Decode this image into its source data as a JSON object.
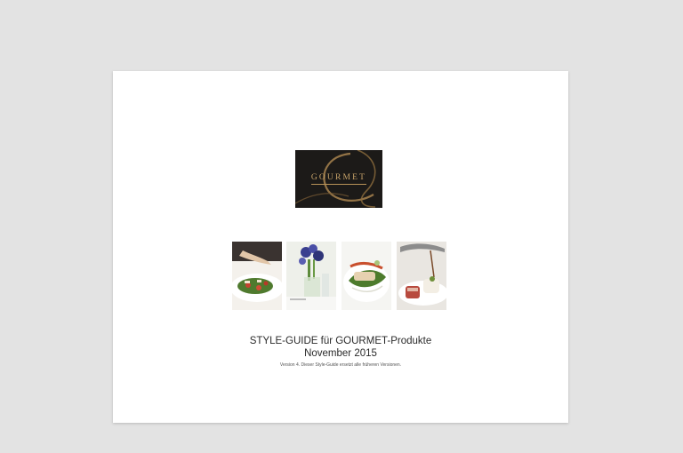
{
  "document": {
    "logo": {
      "text": "GOURMET",
      "background": "#1c1a18",
      "accent": "#c8a46a"
    },
    "photos": [
      {
        "subject": "salad-plate-photo"
      },
      {
        "subject": "flowers-table-photo"
      },
      {
        "subject": "fish-dish-photo"
      },
      {
        "subject": "meat-dish-photo"
      }
    ],
    "title": "STYLE-GUIDE für GOURMET-Produkte",
    "subtitle": "November 2015",
    "version_note": "Version 4. Dieser Style-Guide ersetzt alle früheren Versionen."
  }
}
